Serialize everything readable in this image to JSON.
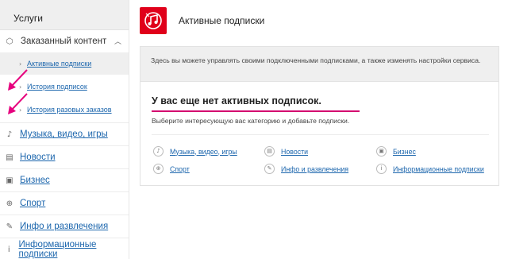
{
  "sidebar": {
    "title": "Услуги",
    "parent": {
      "label": "Заказанный контент",
      "icon": "box-icon",
      "chevron": "chevron-up-icon"
    },
    "subitems": [
      {
        "label": "Активные подписки"
      },
      {
        "label": "История подписок"
      },
      {
        "label": "История разовых заказов"
      }
    ],
    "items": [
      {
        "label": "Музыка, видео, игры",
        "icon": "music-icon"
      },
      {
        "label": "Новости",
        "icon": "newspaper-icon"
      },
      {
        "label": "Бизнес",
        "icon": "briefcase-icon"
      },
      {
        "label": "Спорт",
        "icon": "ball-icon"
      },
      {
        "label": "Инфо и развлечения",
        "icon": "pen-icon"
      },
      {
        "label": "Информационные подписки",
        "icon": "info-icon"
      }
    ]
  },
  "main": {
    "title": "Активные подписки",
    "info": "Здесь вы можете управлять своими подключенными подписками, а также изменять настройки сервиса.",
    "empty_title": "У вас еще нет активных подписок.",
    "empty_subtitle": "Выберите интересующую вас категорию и добавьте подписки.",
    "categories": [
      {
        "label": "Музыка, видео, игры",
        "icon": "music-icon"
      },
      {
        "label": "Новости",
        "icon": "newspaper-icon"
      },
      {
        "label": "Бизнес",
        "icon": "briefcase-icon"
      },
      {
        "label": "Спорт",
        "icon": "ball-icon"
      },
      {
        "label": "Инфо и развлечения",
        "icon": "pen-icon"
      },
      {
        "label": "Информационные подписки",
        "icon": "info-icon"
      }
    ]
  },
  "colors": {
    "accent": "#e0001a",
    "link": "#1c66ad",
    "underline": "#d4006f",
    "annotation": "#e6007e"
  }
}
